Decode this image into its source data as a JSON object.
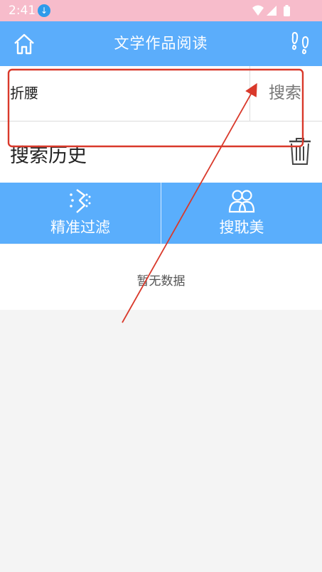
{
  "status_bar": {
    "time": "2:41"
  },
  "app_bar": {
    "title": "文学作品阅读"
  },
  "search": {
    "query": "折腰",
    "button_label": "搜索"
  },
  "history": {
    "title": "搜索历史"
  },
  "tabs": [
    {
      "label": "精准过滤"
    },
    {
      "label": "搜耽美"
    }
  ],
  "empty_state": {
    "text": "暂无数据"
  },
  "colors": {
    "status_bar": "#f7bccb",
    "app_bar": "#5badfb",
    "tab_bar": "#5aaefc",
    "annotation": "#d9392b"
  }
}
